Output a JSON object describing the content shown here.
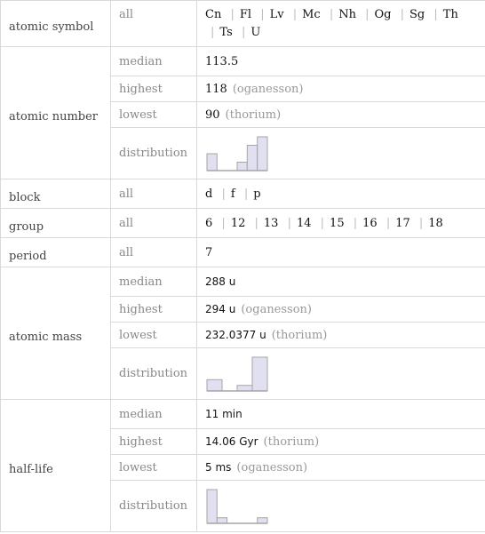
{
  "rows": {
    "atomic_symbol": {
      "label": "atomic symbol",
      "sub": "all",
      "values": [
        "Cn",
        "Fl",
        "Lv",
        "Mc",
        "Nh",
        "Og",
        "Sg",
        "Th",
        "Ts",
        "U"
      ]
    },
    "atomic_number": {
      "label": "atomic number",
      "median": {
        "label": "median",
        "value": "113.5"
      },
      "highest": {
        "label": "highest",
        "value": "118",
        "note": "(oganesson)"
      },
      "lowest": {
        "label": "lowest",
        "value": "90",
        "note": "(thorium)"
      },
      "distribution": {
        "label": "distribution"
      }
    },
    "block": {
      "label": "block",
      "sub": "all",
      "values": [
        "d",
        "f",
        "p"
      ]
    },
    "group": {
      "label": "group",
      "sub": "all",
      "values": [
        "6",
        "12",
        "13",
        "14",
        "15",
        "16",
        "17",
        "18"
      ]
    },
    "period": {
      "label": "period",
      "sub": "all",
      "value": "7"
    },
    "atomic_mass": {
      "label": "atomic mass",
      "median": {
        "label": "median",
        "value": "288",
        "unit": "u"
      },
      "highest": {
        "label": "highest",
        "value": "294",
        "unit": "u",
        "note": "(oganesson)"
      },
      "lowest": {
        "label": "lowest",
        "value": "232.0377",
        "unit": "u",
        "note": "(thorium)"
      },
      "distribution": {
        "label": "distribution"
      }
    },
    "half_life": {
      "label": "half-life",
      "median": {
        "label": "median",
        "value": "11",
        "unit": "min"
      },
      "highest": {
        "label": "highest",
        "value": "14.06",
        "unit": "Gyr",
        "note": "(thorium)"
      },
      "lowest": {
        "label": "lowest",
        "value": "5",
        "unit": "ms",
        "note": "(oganesson)"
      },
      "distribution": {
        "label": "distribution"
      }
    }
  },
  "chart_data": [
    {
      "type": "bar",
      "title": "atomic number distribution",
      "counts": [
        2,
        0,
        0,
        1,
        3,
        4
      ],
      "colors": {
        "fill": "#e0e0f0",
        "stroke": "#a6a6a6"
      }
    },
    {
      "type": "bar",
      "title": "atomic mass distribution",
      "counts": [
        1,
        0,
        0.5,
        3
      ],
      "colors": {
        "fill": "#e0e0f0",
        "stroke": "#a6a6a6"
      }
    },
    {
      "type": "bar",
      "title": "half-life distribution",
      "counts": [
        6,
        1,
        0,
        0,
        0,
        1
      ],
      "colors": {
        "fill": "#e0e0f0",
        "stroke": "#a6a6a6"
      }
    }
  ]
}
